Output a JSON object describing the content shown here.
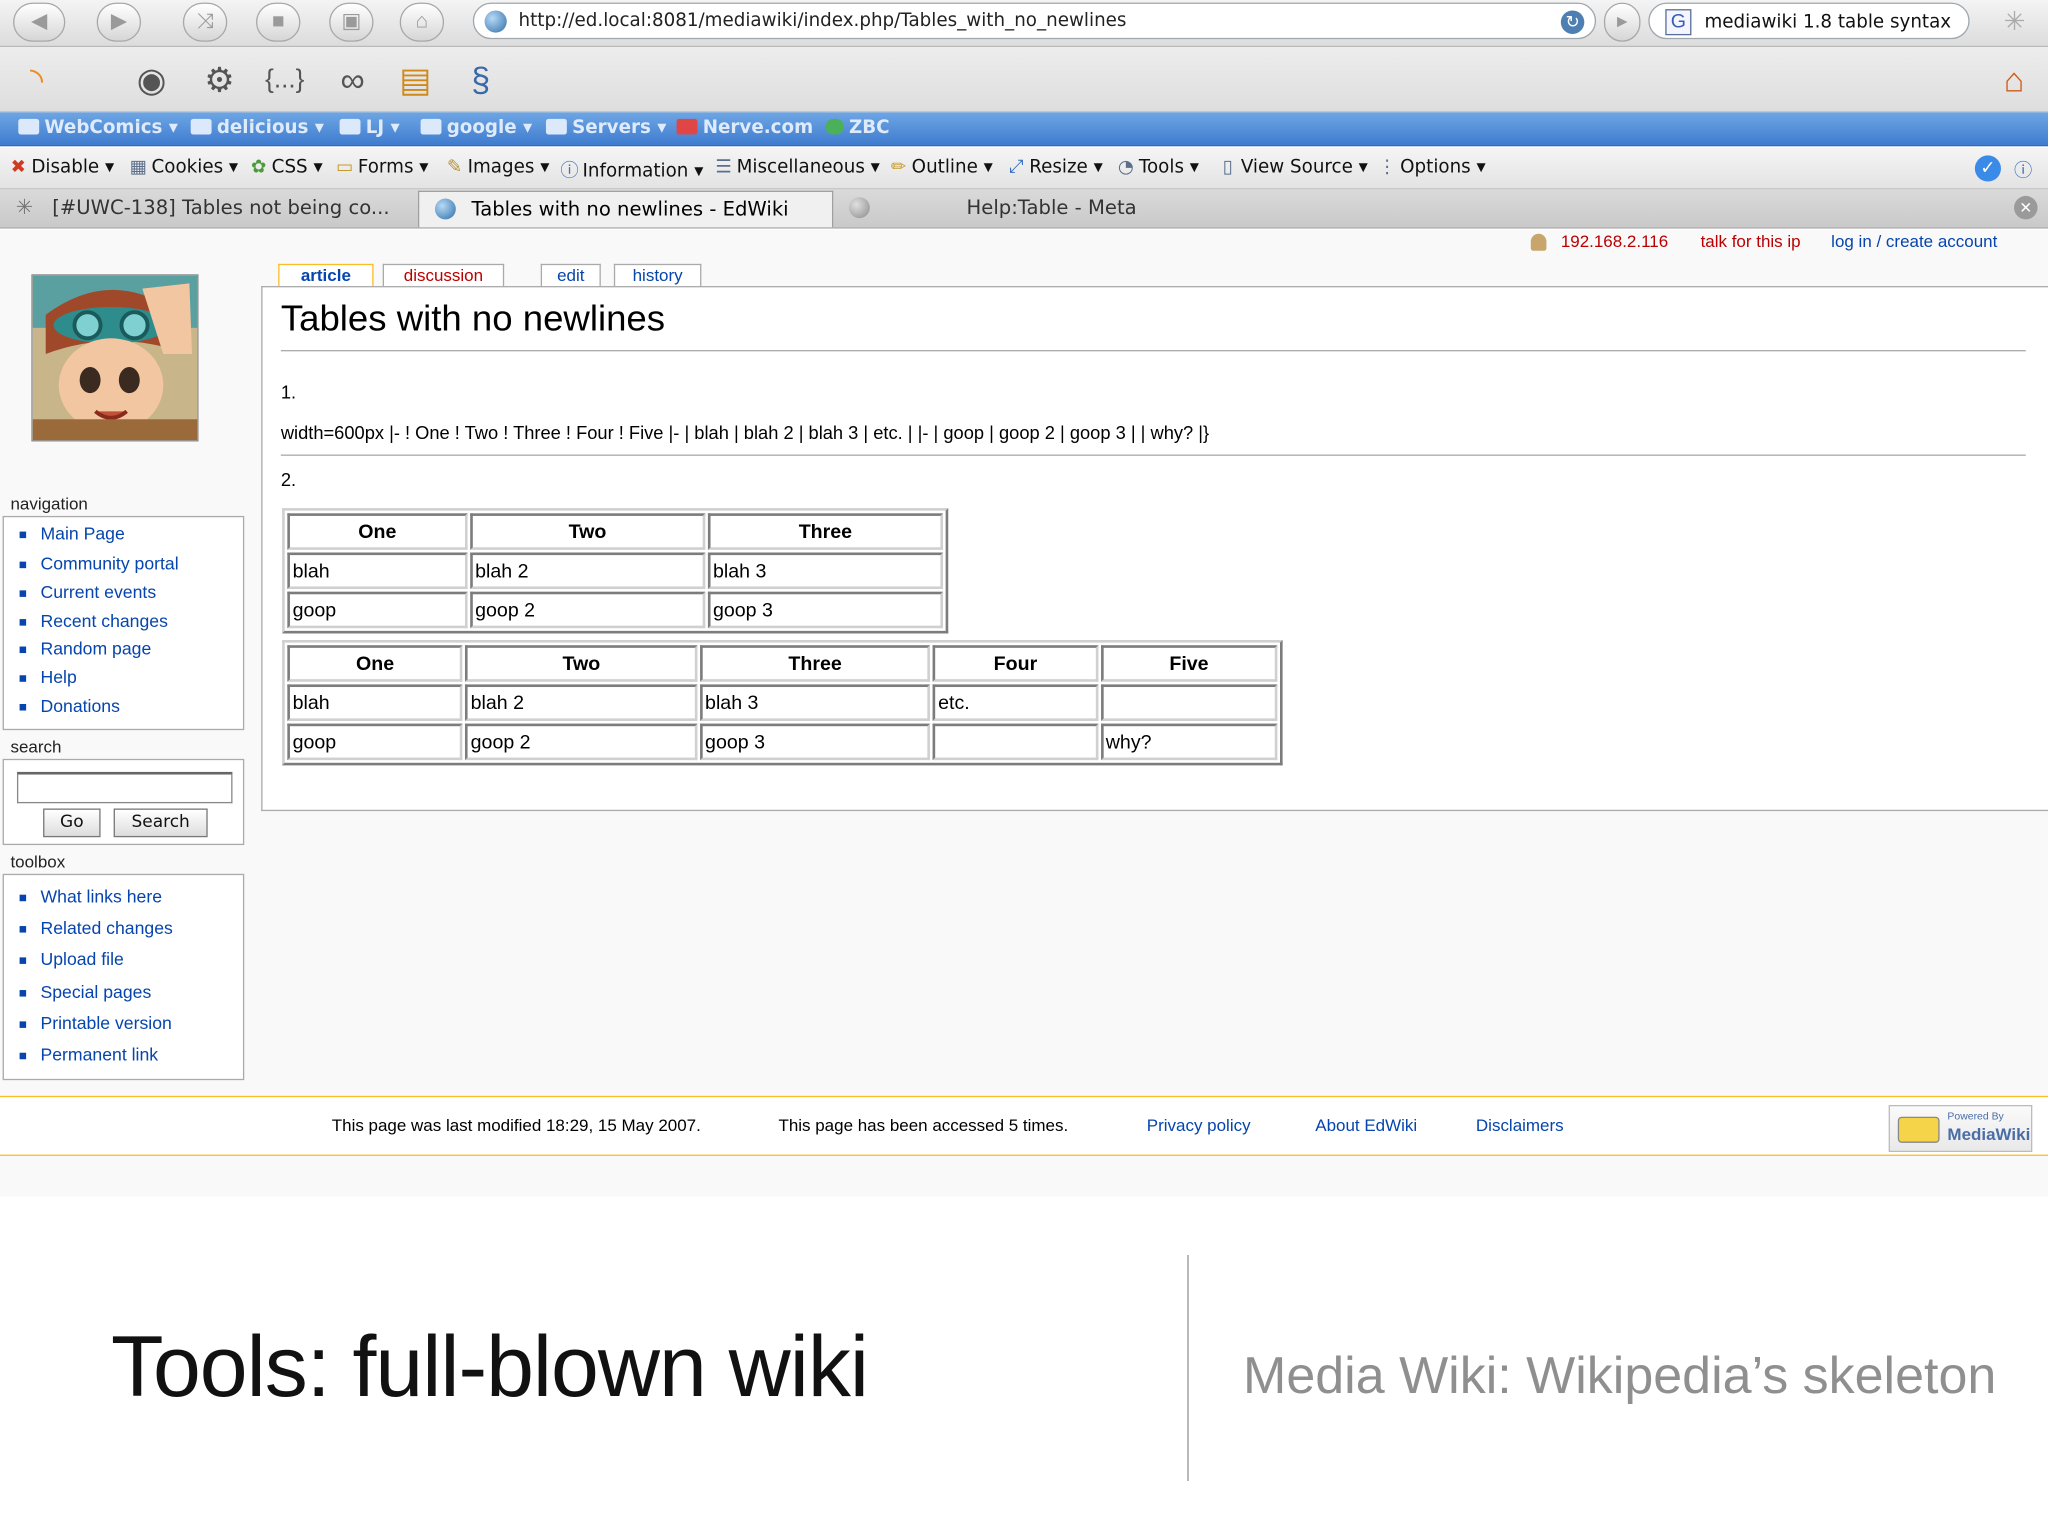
{
  "browser": {
    "url": "http://ed.local:8081/mediawiki/index.php/Tables_with_no_newlines",
    "search_query": "mediawiki 1.8 table syntax",
    "bookmarks": [
      "WebComics ▾",
      "delicious ▾",
      "LJ ▾",
      "google ▾",
      "Servers ▾",
      "Nerve.com",
      "ZBC"
    ],
    "dev_toolbar": [
      "Disable ▾",
      "Cookies ▾",
      "CSS ▾",
      "Forms ▾",
      "Images ▾",
      "Information ▾",
      "Miscellaneous ▾",
      "Outline ▾",
      "Resize ▾",
      "Tools ▾",
      "View Source ▾",
      "Options ▾"
    ],
    "tabs": [
      {
        "title": "[#UWC-138] Tables not being co..."
      },
      {
        "title": "Tables with no newlines - EdWiki"
      },
      {
        "title": "Help:Table - Meta"
      }
    ]
  },
  "wiki": {
    "personal": {
      "ip": "192.168.2.116",
      "talk": "talk for this ip",
      "login": "log in / create account"
    },
    "content_tabs": [
      "article",
      "discussion",
      "edit",
      "history"
    ],
    "title": "Tables with no newlines",
    "item1_num": "1.",
    "item1_text": "width=600px |- ! One ! Two ! Three ! Four ! Five |- | blah | blah 2 | blah 3 | etc. | |- | goop | goop 2 | goop 3 | | why? |}",
    "item2_num": "2.",
    "table1": {
      "headers": [
        "One",
        "Two",
        "Three"
      ],
      "rows": [
        [
          "blah",
          "blah 2",
          "blah 3"
        ],
        [
          "goop",
          "goop 2",
          "goop 3"
        ]
      ]
    },
    "table2": {
      "headers": [
        "One",
        "Two",
        "Three",
        "Four",
        "Five"
      ],
      "rows": [
        [
          "blah",
          "blah 2",
          "blah 3",
          "etc.",
          ""
        ],
        [
          "goop",
          "goop 2",
          "goop 3",
          "",
          "why?"
        ]
      ]
    },
    "navigation": {
      "heading": "navigation",
      "items": [
        "Main Page",
        "Community portal",
        "Current events",
        "Recent changes",
        "Random page",
        "Help",
        "Donations"
      ]
    },
    "search": {
      "heading": "search",
      "go": "Go",
      "search": "Search"
    },
    "toolbox": {
      "heading": "toolbox",
      "items": [
        "What links here",
        "Related changes",
        "Upload file",
        "Special pages",
        "Printable version",
        "Permanent link"
      ]
    },
    "footer": {
      "modified": "This page was last modified 18:29, 15 May 2007.",
      "accessed": "This page has been accessed 5 times.",
      "links": [
        "Privacy policy",
        "About EdWiki",
        "Disclaimers"
      ],
      "powered_top": "Powered By",
      "powered_bottom": "MediaWiki"
    }
  },
  "slide": {
    "title": "Tools: full-blown wiki",
    "subtitle": "Media Wiki: Wikipedia’s skeleton"
  }
}
